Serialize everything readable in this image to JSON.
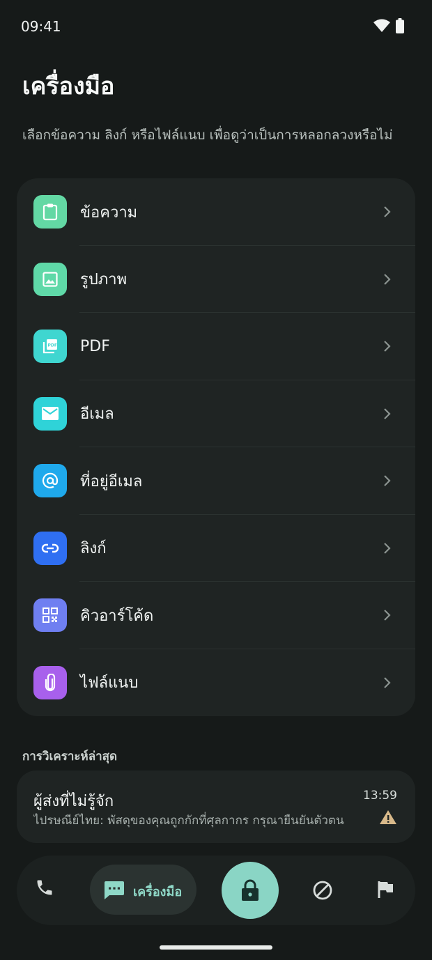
{
  "status_bar": {
    "time": "09:41"
  },
  "page": {
    "title": "เครื่องมือ",
    "subtitle": "เลือกข้อความ ลิงก์ หรือไฟล์แนบ เพื่อดูว่าเป็นการหลอกลวงหรือไม่"
  },
  "tools": [
    {
      "label": "ข้อความ",
      "icon": "clipboard-icon",
      "color": "#63d8a4"
    },
    {
      "label": "รูปภาพ",
      "icon": "image-icon",
      "color": "#5fd9a8"
    },
    {
      "label": "PDF",
      "icon": "pdf-icon",
      "color": "#3fd6d0"
    },
    {
      "label": "อีเมล",
      "icon": "mail-icon",
      "color": "#2fd3d8"
    },
    {
      "label": "ที่อยู่อีเมล",
      "icon": "at-icon",
      "color": "#1fa9ec"
    },
    {
      "label": "ลิงก์",
      "icon": "link-icon",
      "color": "#2f6ff2"
    },
    {
      "label": "คิวอาร์โค้ด",
      "icon": "qr-code-icon",
      "color": "#6f7ff1"
    },
    {
      "label": "ไฟล์แนบ",
      "icon": "paperclip-icon",
      "color": "#a860ec"
    }
  ],
  "recent": {
    "section_title": "การวิเคราะห์ล่าสุด",
    "sender": "ผู้ส่งที่ไม่รู้จัก",
    "preview": "ไปรษณีย์ไทย: พัสดุของคุณถูกกักที่ศุลกากร กรุณายืนยันตัวตน",
    "time": "13:59",
    "warning_color": "#d8b98a"
  },
  "nav": {
    "tools_label": "เครื่องมือ",
    "accent": "#8ad5c5"
  }
}
